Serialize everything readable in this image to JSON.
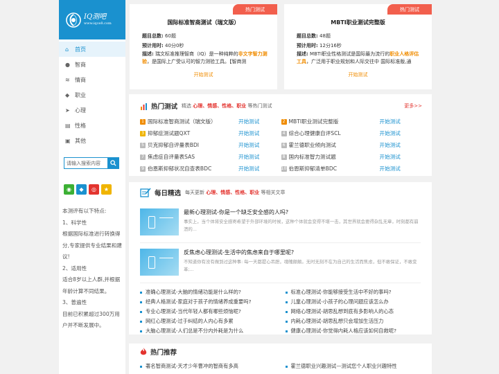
{
  "logo": {
    "name": "IQ测吧",
    "url": "www.iqce8.com"
  },
  "nav": [
    {
      "label": "首页",
      "icon": "home-icon",
      "glyph": "⌂"
    },
    {
      "label": "智商",
      "icon": "chat-icon",
      "glyph": "●"
    },
    {
      "label": "情商",
      "icon": "rss-icon",
      "glyph": "≋"
    },
    {
      "label": "职业",
      "icon": "tag-icon",
      "glyph": "◆"
    },
    {
      "label": "心理",
      "icon": "paper-plane-icon",
      "glyph": "➤"
    },
    {
      "label": "性格",
      "icon": "book-icon",
      "glyph": "▤"
    },
    {
      "label": "其他",
      "icon": "image-icon",
      "glyph": "▣"
    }
  ],
  "search": {
    "placeholder": "请输入搜索内容"
  },
  "share": [
    {
      "icon": "wechat-icon",
      "glyph": "◉",
      "color": "#3cb034"
    },
    {
      "icon": "qq-icon",
      "glyph": "◆",
      "color": "#1a91cf"
    },
    {
      "icon": "weibo-icon",
      "glyph": "◎",
      "color": "#e3342f"
    },
    {
      "icon": "qzone-icon",
      "glyph": "★",
      "color": "#f0b400"
    }
  ],
  "features": [
    "本测评有以下特点:",
    "1、科学性",
    "根据国际标准进行转换得分,专家提供专业结果和建议!",
    "2、适用性",
    "适合8岁以上人群,并根据年龄计算不同结果。",
    "3、普遍性",
    "目前已积累超过300万用户并不断发展中。"
  ],
  "top_cards": [
    {
      "badge": "热门测试",
      "title": "国际标准智商测试（瑞文版）",
      "count_label": "题目总数:",
      "count": "60题",
      "time_label": "预计用时:",
      "time": "40分0秒",
      "desc_label": "描述:",
      "desc_a": "瑞文标准推理智商（IQ）是一种纯粹的",
      "desc_hl": "非文字智力测验",
      "desc_b": "，是国际上广受认可的智力测验工具。【智商测",
      "start": "开始测试"
    },
    {
      "badge": "热门测试",
      "title": "MBTI职业测试完整版",
      "count_label": "题目总数:",
      "count": "48题",
      "time_label": "预计用时:",
      "time": "12分16秒",
      "desc_label": "描述:",
      "desc_a": "MBTI职业性格测试是国际最为流行的",
      "desc_hl": "职业人格评估工具",
      "desc_b": "，广泛用于职业规划和人际交往中 国际标准版,通",
      "start": "开始测试"
    }
  ],
  "hot": {
    "title": "热门测试",
    "sub_a": "精选",
    "tags": [
      "心理、",
      "情感、",
      "性格、",
      "职业"
    ],
    "sub_b": "等热门测试",
    "more": "更多>>",
    "items": [
      {
        "n": "1",
        "name": "国际标准智商测试（瑞文版）",
        "go": "开始测试",
        "color": "#f08c00"
      },
      {
        "n": "2",
        "name": "MBTI职业测试完整版",
        "go": "开始测试",
        "color": "#f08c00"
      },
      {
        "n": "3",
        "name": "抑郁症测试题QXT",
        "go": "开始测试",
        "color": "#f0b400"
      },
      {
        "n": "4",
        "name": "综合心理健康自评SCL",
        "go": "开始测试",
        "color": "#bbbbbb"
      },
      {
        "n": "5",
        "name": "贝克抑郁自评量表BDI",
        "go": "开始测试",
        "color": "#bbbbbb"
      },
      {
        "n": "6",
        "name": "霍兰德职业倾向测试",
        "go": "开始测试",
        "color": "#bbbbbb"
      },
      {
        "n": "7",
        "name": "焦虑症自评量表SAS",
        "go": "开始测试",
        "color": "#bbbbbb"
      },
      {
        "n": "8",
        "name": "国内标准智力测试题",
        "go": "开始测试",
        "color": "#bbbbbb"
      },
      {
        "n": "9",
        "name": "伯恩斯抑郁状况自查表BDC",
        "go": "开始测试",
        "color": "#bbbbbb"
      },
      {
        "n": "10",
        "name": "伯恩斯抑郁清单BDC",
        "go": "开始测试",
        "color": "#bbbbbb"
      }
    ]
  },
  "daily": {
    "title": "每日精选",
    "sub_a": "每天更新",
    "tags": [
      "心理、",
      "情感、",
      "性格、",
      "职业"
    ],
    "sub_b": "等相关文章",
    "articles": [
      {
        "title": "最新心理测试-你是一个缺乏安全感的人吗?",
        "desc": "事实上，当个体将安全感寄希望于外部环境的时候，这种个体就会变得不堪一击，其世界就会要得杂乱无章，时刻都有崩溃的..."
      },
      {
        "title": "反焦虑心理测试-生活中的焦虑来自于哪里呢?",
        "desc": "不知道你有没有做到过这种事: 每一天都提心吊胆，魂魄颠颠。无时无刻不在为自己的生活而焦虑，但不敢保证，不敢变革;..."
      }
    ],
    "links": [
      "准确心理测试-大脑的情绪功能是什么样的?",
      "标准心理测试-你能够接受生活中不好的事吗?",
      "经典人格测试-家庭对于孩子的情绪养成重要吗?",
      "儿童心理测试-小孩子的心理问题应该怎么办",
      "专业心理测试-当代年轻人都有哪些烦恼呢?",
      "网络心理测试-胡思乱想到底有多影响人的心态",
      "网红心理测试-过于纠结的人内心有多累",
      "内耗心理测试-胡思乱想只会增加生活压力",
      "大脑心理测试-人们总是不分内外耗是为什么",
      "健康心理测试-你觉得内耗人格应该如何自救呢?"
    ]
  },
  "recommend": {
    "title": "热门推荐",
    "links": [
      "著名智商测试-天才少年曹冲的智商有多高",
      "霍兰德职业兴趣测试—测试您个人职业兴趣特性"
    ]
  }
}
